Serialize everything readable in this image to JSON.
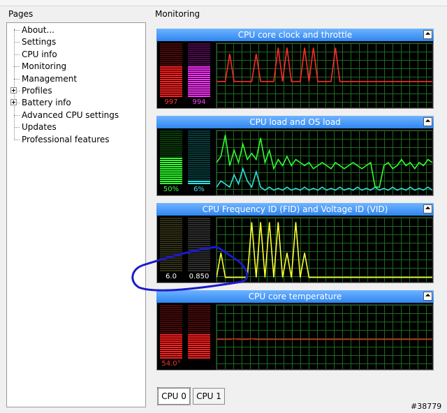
{
  "pages_title": "Pages",
  "monitoring_title": "Monitoring",
  "tree": [
    {
      "label": "About...",
      "expandable": false
    },
    {
      "label": "Settings",
      "expandable": false
    },
    {
      "label": "CPU info",
      "expandable": false
    },
    {
      "label": "Monitoring",
      "expandable": false
    },
    {
      "label": "Management",
      "expandable": false
    },
    {
      "label": "Profiles",
      "expandable": true
    },
    {
      "label": "Battery info",
      "expandable": true
    },
    {
      "label": "Advanced CPU settings",
      "expandable": false
    },
    {
      "label": "Updates",
      "expandable": false
    },
    {
      "label": "Professional features",
      "expandable": false
    }
  ],
  "panels": [
    {
      "title": "CPU core clock and throttle",
      "meters": [
        {
          "value": "997",
          "color": "#ff2020",
          "dim": "#4a0a0a",
          "level": 0.58,
          "text_color": "#ff3030"
        },
        {
          "value": "994",
          "color": "#ff30ff",
          "dim": "#4a0a4a",
          "level": 0.58,
          "text_color": "#ff40ff"
        }
      ],
      "series": [
        {
          "color": "#ff2a2a",
          "values": [
            0.4,
            0.4,
            0.4,
            0.85,
            0.4,
            0.4,
            0.4,
            0.4,
            0.4,
            0.85,
            0.4,
            0.4,
            0.4,
            0.4,
            0.95,
            0.4,
            0.95,
            0.4,
            0.4,
            0.4,
            0.95,
            0.4,
            0.95,
            0.4,
            0.4,
            0.4,
            0.4,
            0.95,
            0.4,
            0.4,
            0.4,
            0.4,
            0.4,
            0.4,
            0.4,
            0.4,
            0.4,
            0.4,
            0.4,
            0.4,
            0.4,
            0.4,
            0.4,
            0.4,
            0.4,
            0.4,
            0.4,
            0.4,
            0.4,
            0.4
          ]
        }
      ]
    },
    {
      "title": "CPU load and OS load",
      "meters": [
        {
          "value": "50%",
          "color": "#30ff30",
          "dim": "#0a3a0a",
          "level": 0.5,
          "text_color": "#40ff40"
        },
        {
          "value": "6%",
          "color": "#30e0e0",
          "dim": "#0a3a3a",
          "level": 0.06,
          "text_color": "#40e0e0"
        }
      ],
      "series": [
        {
          "color": "#30ff30",
          "values": [
            0.5,
            0.6,
            0.95,
            0.45,
            0.7,
            0.5,
            0.8,
            0.55,
            0.65,
            0.55,
            0.9,
            0.5,
            0.7,
            0.4,
            0.55,
            0.45,
            0.6,
            0.45,
            0.55,
            0.5,
            0.45,
            0.5,
            0.4,
            0.45,
            0.5,
            0.45,
            0.4,
            0.5,
            0.45,
            0.4,
            0.45,
            0.5,
            0.45,
            0.4,
            0.45,
            0.5,
            0.1,
            0.1,
            0.45,
            0.5,
            0.4,
            0.45,
            0.55,
            0.45,
            0.5,
            0.4,
            0.5,
            0.45,
            0.55,
            0.5
          ]
        },
        {
          "color": "#30e0e0",
          "values": [
            0.1,
            0.2,
            0.15,
            0.1,
            0.3,
            0.15,
            0.4,
            0.2,
            0.1,
            0.35,
            0.1,
            0.05,
            0.1,
            0.05,
            0.08,
            0.05,
            0.1,
            0.05,
            0.08,
            0.05,
            0.1,
            0.05,
            0.08,
            0.05,
            0.1,
            0.05,
            0.08,
            0.05,
            0.1,
            0.05,
            0.08,
            0.05,
            0.1,
            0.05,
            0.08,
            0.05,
            0.1,
            0.05,
            0.08,
            0.05,
            0.1,
            0.05,
            0.08,
            0.05,
            0.1,
            0.05,
            0.08,
            0.05,
            0.1,
            0.05
          ]
        }
      ]
    },
    {
      "title": "CPU Frequency ID (FID) and Voltage ID (VID)",
      "meters": [
        {
          "value": "6.0",
          "color": "#8a8a50",
          "dim": "#303018",
          "level": 0.0,
          "text_color": "#ffffff"
        },
        {
          "value": "0.850",
          "color": "#9a9a9a",
          "dim": "#2e2e2e",
          "level": 0.0,
          "text_color": "#ffffff"
        }
      ],
      "series": [
        {
          "color": "#ffff30",
          "values": [
            0.05,
            0.45,
            0.05,
            0.05,
            0.05,
            0.05,
            0.05,
            0.05,
            0.95,
            0.05,
            0.95,
            0.05,
            0.95,
            0.05,
            0.95,
            0.05,
            0.45,
            0.05,
            0.95,
            0.05,
            0.45,
            0.05,
            0.05,
            0.05,
            0.05,
            0.05,
            0.05,
            0.05,
            0.05,
            0.05,
            0.05,
            0.05,
            0.05,
            0.05,
            0.05,
            0.05,
            0.05,
            0.05,
            0.05,
            0.05,
            0.05,
            0.05,
            0.05,
            0.05,
            0.05,
            0.05,
            0.05,
            0.05,
            0.05,
            0.05
          ]
        }
      ]
    },
    {
      "title": "CPU core temperature",
      "meters": [
        {
          "value": "54.0°",
          "color": "#ff2020",
          "dim": "#4a0a0a",
          "level": 0.45,
          "text_color": "#ff3030"
        },
        {
          "value": "",
          "color": "#ff2020",
          "dim": "#4a0a0a",
          "level": 0.45,
          "text_color": "#ff3030"
        }
      ],
      "series": [
        {
          "color": "#e02020",
          "values": [
            0.46,
            0.46,
            0.46,
            0.46,
            0.47,
            0.46,
            0.46,
            0.46,
            0.47,
            0.46,
            0.46,
            0.46,
            0.46,
            0.46,
            0.46,
            0.46,
            0.46,
            0.46,
            0.46,
            0.46,
            0.46,
            0.46,
            0.46,
            0.46,
            0.46,
            0.46,
            0.46,
            0.46,
            0.46,
            0.46,
            0.46,
            0.46,
            0.46,
            0.46,
            0.46,
            0.46,
            0.46,
            0.46,
            0.46,
            0.46,
            0.46,
            0.46,
            0.46,
            0.46,
            0.46,
            0.46,
            0.46,
            0.46,
            0.46,
            0.46
          ]
        }
      ]
    }
  ],
  "collapse_glyph": "⏶",
  "tabs": [
    {
      "label": "CPU 0",
      "active": true
    },
    {
      "label": "CPU 1",
      "active": false
    }
  ],
  "watermark": "#38779"
}
